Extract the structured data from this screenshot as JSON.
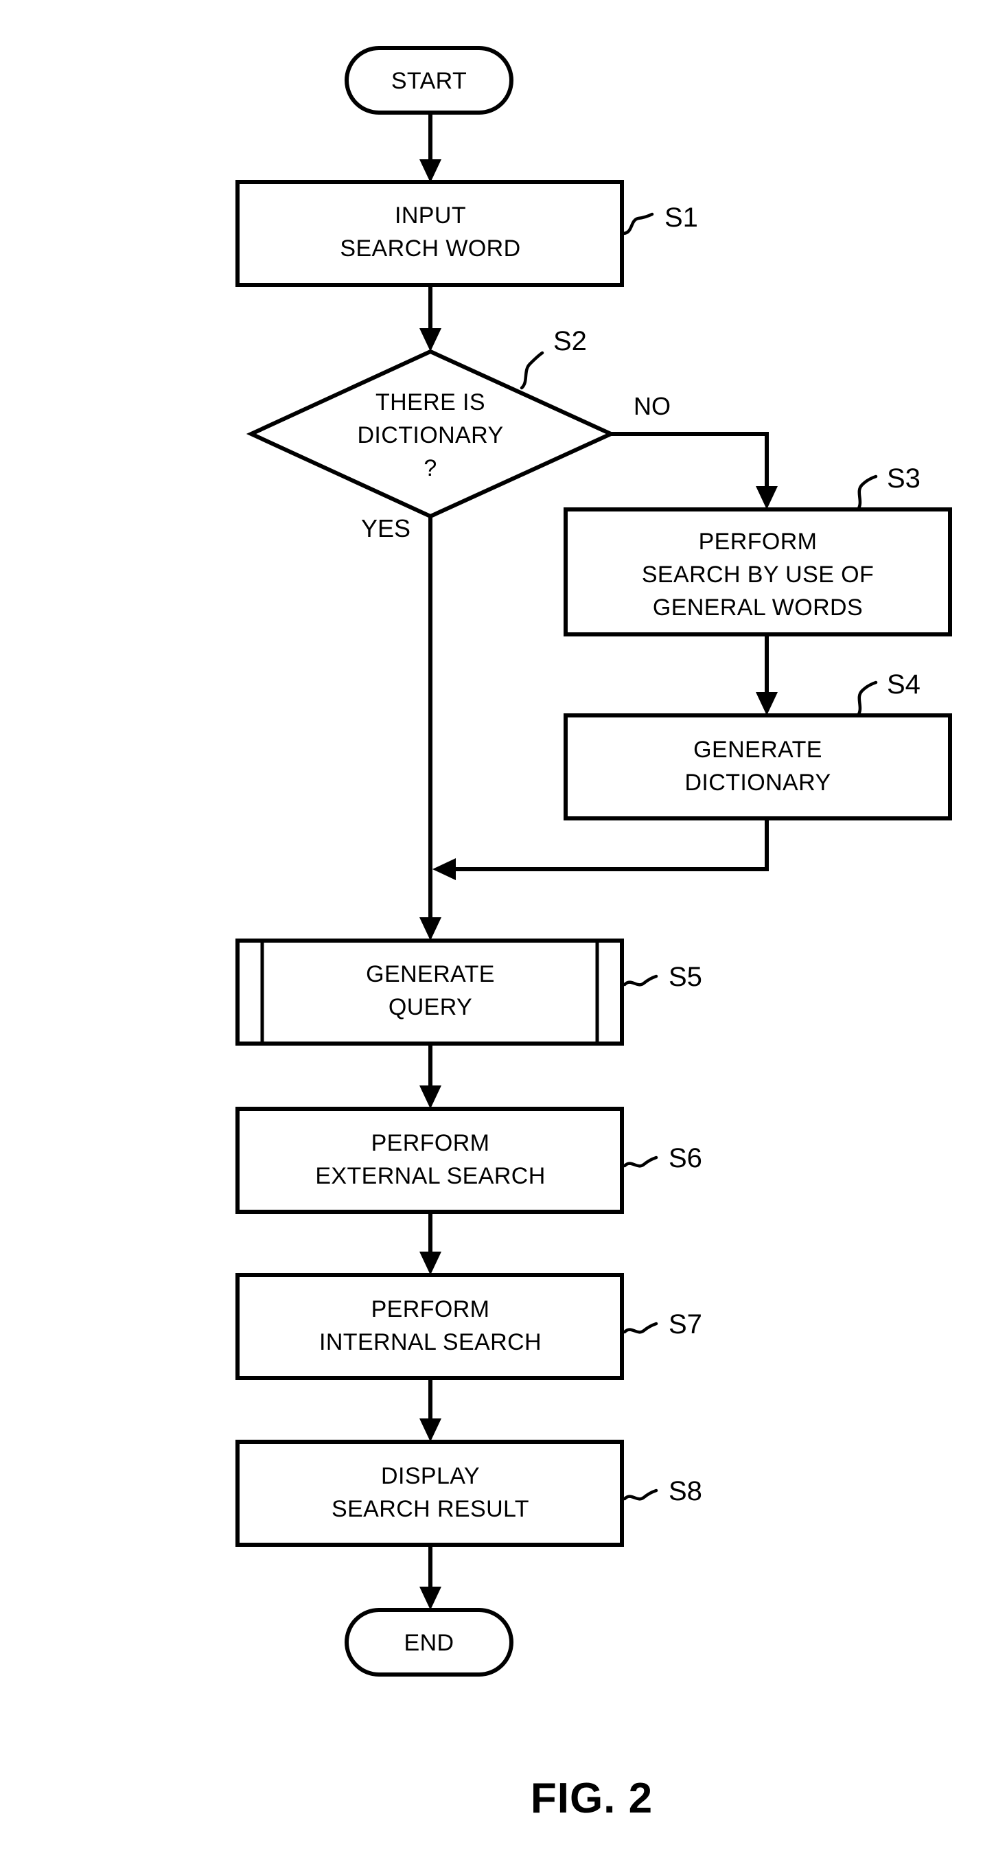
{
  "figure": {
    "caption": "FIG. 2",
    "type": "flowchart"
  },
  "nodes": {
    "start": {
      "id": "start",
      "shape": "terminator",
      "label": "START"
    },
    "s1": {
      "id": "S1",
      "shape": "process",
      "step_label": "S1",
      "line1": "INPUT",
      "line2": "SEARCH WORD"
    },
    "s2": {
      "id": "S2",
      "shape": "decision",
      "step_label": "S2",
      "line1": "THERE IS",
      "line2": "DICTIONARY",
      "line3": "?",
      "yes_label": "YES",
      "no_label": "NO"
    },
    "s3": {
      "id": "S3",
      "shape": "process",
      "step_label": "S3",
      "line1": "PERFORM",
      "line2": "SEARCH BY USE OF",
      "line3": "GENERAL WORDS"
    },
    "s4": {
      "id": "S4",
      "shape": "process",
      "step_label": "S4",
      "line1": "GENERATE",
      "line2": "DICTIONARY"
    },
    "s5": {
      "id": "S5",
      "shape": "predefined-process",
      "step_label": "S5",
      "line1": "GENERATE",
      "line2": "QUERY"
    },
    "s6": {
      "id": "S6",
      "shape": "process",
      "step_label": "S6",
      "line1": "PERFORM",
      "line2": "EXTERNAL SEARCH"
    },
    "s7": {
      "id": "S7",
      "shape": "process",
      "step_label": "S7",
      "line1": "PERFORM",
      "line2": "INTERNAL SEARCH"
    },
    "s8": {
      "id": "S8",
      "shape": "process",
      "step_label": "S8",
      "line1": "DISPLAY",
      "line2": "SEARCH RESULT"
    },
    "end": {
      "id": "end",
      "shape": "terminator",
      "label": "END"
    }
  },
  "colors": {
    "stroke": "#000000",
    "fill": "#ffffff",
    "background": "#ffffff"
  }
}
